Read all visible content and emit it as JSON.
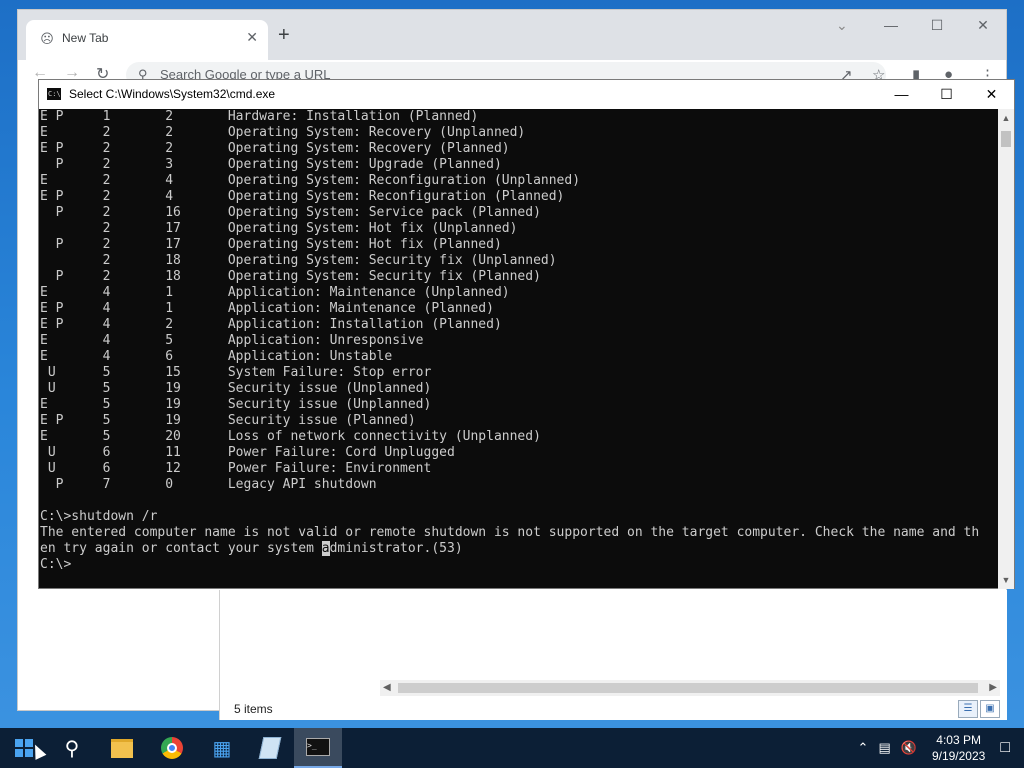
{
  "browser": {
    "tab_title": "New Tab",
    "new_tab_symbol": "+",
    "omnibox_placeholder": "Search Google or type a URL",
    "window_buttons": [
      "—",
      "☐",
      "✕"
    ]
  },
  "explorer": {
    "status_text": "5 items"
  },
  "cmd": {
    "title": "Select C:\\Windows\\System32\\cmd.exe",
    "icon_text": "C:\\",
    "output_lines": [
      "E P     1       2       Hardware: Installation (Planned)",
      "E       2       2       Operating System: Recovery (Unplanned)",
      "E P     2       2       Operating System: Recovery (Planned)",
      "  P     2       3       Operating System: Upgrade (Planned)",
      "E       2       4       Operating System: Reconfiguration (Unplanned)",
      "E P     2       4       Operating System: Reconfiguration (Planned)",
      "  P     2       16      Operating System: Service pack (Planned)",
      "        2       17      Operating System: Hot fix (Unplanned)",
      "  P     2       17      Operating System: Hot fix (Planned)",
      "        2       18      Operating System: Security fix (Unplanned)",
      "  P     2       18      Operating System: Security fix (Planned)",
      "E       4       1       Application: Maintenance (Unplanned)",
      "E P     4       1       Application: Maintenance (Planned)",
      "E P     4       2       Application: Installation (Planned)",
      "E       4       5       Application: Unresponsive",
      "E       4       6       Application: Unstable",
      " U      5       15      System Failure: Stop error",
      " U      5       19      Security issue (Unplanned)",
      "E       5       19      Security issue (Unplanned)",
      "E P     5       19      Security issue (Planned)",
      "E       5       20      Loss of network connectivity (Unplanned)",
      " U      6       11      Power Failure: Cord Unplugged",
      " U      6       12      Power Failure: Environment",
      "  P     7       0       Legacy API shutdown",
      "",
      "C:\\>shutdown /r",
      "The entered computer name is not valid or remote shutdown is not supported on the target computer. Check the name and th"
    ],
    "line_before": "en try again or contact your system ",
    "line_cursor_char": "a",
    "line_after": "dministrator.(53)",
    "blank_line": "",
    "prompt": "C:\\>"
  },
  "taskbar": {
    "time": "4:03 PM",
    "date": "9/19/2023",
    "pinned": [
      "start",
      "search",
      "file-explorer",
      "chrome",
      "server-manager",
      "notepad",
      "cmd"
    ]
  }
}
